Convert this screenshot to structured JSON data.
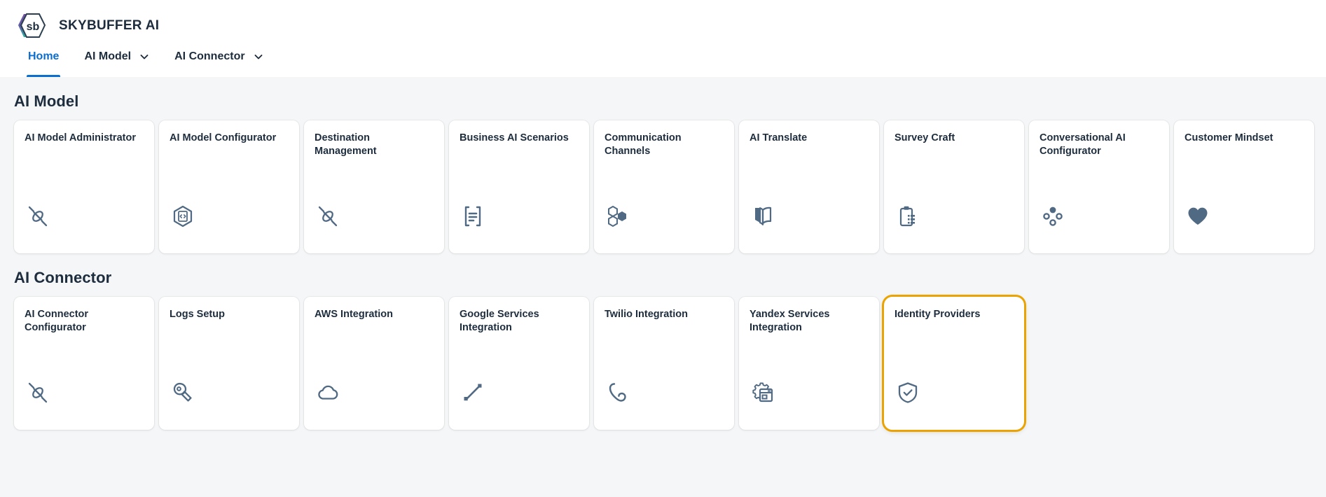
{
  "header": {
    "brand_title": "SKYBUFFER AI",
    "logo_icon": "skybuffer-hexagon-logo",
    "logo_text": "sb"
  },
  "tabs": [
    {
      "label": "Home",
      "active": true,
      "has_menu": false,
      "icon": ""
    },
    {
      "label": "AI Model",
      "active": false,
      "has_menu": true,
      "icon": "chevron-down-icon"
    },
    {
      "label": "AI Connector",
      "active": false,
      "has_menu": true,
      "icon": "chevron-down-icon"
    }
  ],
  "colors": {
    "accent_blue": "#0a6ed1",
    "selection_orange": "#eaa300",
    "icon_slate": "#516a84",
    "text_dark": "#1d2d3e",
    "page_background": "#f5f6f7",
    "tile_background": "#ffffff"
  },
  "groups": [
    {
      "title": "AI Model",
      "tiles": [
        {
          "title": "AI Model Administrator",
          "icon": "dna-link-icon",
          "selected": false
        },
        {
          "title": "AI Model Configurator",
          "icon": "hexagon-code-icon",
          "selected": false
        },
        {
          "title": "Destination Management",
          "icon": "dna-link-icon",
          "selected": false
        },
        {
          "title": "Business AI Scenarios",
          "icon": "document-list-icon",
          "selected": false
        },
        {
          "title": "Communication Channels",
          "icon": "hexagon-cluster-icon",
          "selected": false
        },
        {
          "title": "AI Translate",
          "icon": "open-book-icon",
          "selected": false
        },
        {
          "title": "Survey Craft",
          "icon": "clipboard-list-icon",
          "selected": false
        },
        {
          "title": "Conversational AI Configurator",
          "icon": "node-dots-icon",
          "selected": false
        },
        {
          "title": "Customer Mindset",
          "icon": "heart-icon",
          "selected": false
        }
      ]
    },
    {
      "title": "AI Connector",
      "tiles": [
        {
          "title": "AI Connector Configurator",
          "icon": "dna-link-icon",
          "selected": false
        },
        {
          "title": "Logs Setup",
          "icon": "wrench-icon",
          "selected": false
        },
        {
          "title": "AWS Integration",
          "icon": "cloud-icon",
          "selected": false
        },
        {
          "title": "Google Services Integration",
          "icon": "connection-line-icon",
          "selected": false
        },
        {
          "title": "Twilio Integration",
          "icon": "phone-handset-icon",
          "selected": false
        },
        {
          "title": "Yandex Services Integration",
          "icon": "gear-window-icon",
          "selected": false
        },
        {
          "title": "Identity Providers",
          "icon": "shield-check-icon",
          "selected": true
        }
      ]
    }
  ]
}
